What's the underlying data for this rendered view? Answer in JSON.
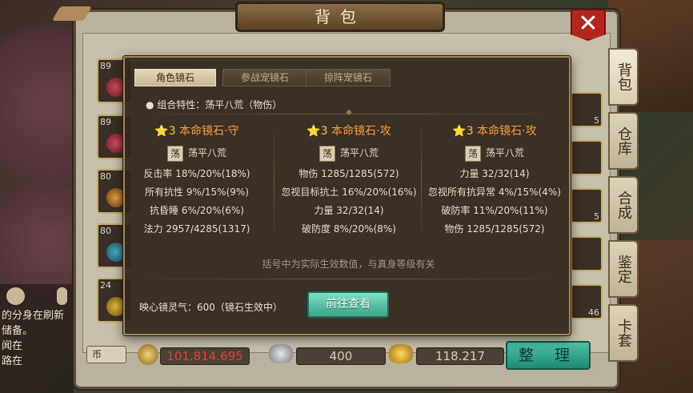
{
  "window": {
    "title": "背包",
    "close_label": "✕"
  },
  "side_tabs": [
    "背包",
    "仓库",
    "合成",
    "鉴定",
    "卡套"
  ],
  "left_slots": [
    "89",
    "89",
    "80",
    "80",
    "24"
  ],
  "right_slots": [
    "5",
    "",
    "5",
    "",
    "46"
  ],
  "currency": {
    "toggle_label": "币",
    "gold": "101.814.695",
    "silver": "400",
    "ingot": "118.217"
  },
  "tidy_label": "整 理",
  "chat_lines": [
    "的分身在刷新",
    "储备。",
    "闻在",
    "路在"
  ],
  "panel": {
    "tabs": [
      "角色镜石",
      "参战宠镜石",
      "掠阵宠镜石"
    ],
    "combo_label": "● 组合特性：荡平八荒（物伤）",
    "columns": [
      {
        "star": "⭐3",
        "title": "本命镜石·守",
        "tag_icon": "荡",
        "tag_text": "荡平八荒",
        "stats": [
          "反击率 18%/20%(18%)",
          "所有抗性 9%/15%(9%)",
          "抗昏睡 6%/20%(6%)",
          "法力 2957/4285(1317)"
        ]
      },
      {
        "star": "⭐3",
        "title": "本命镜石·攻",
        "tag_icon": "荡",
        "tag_text": "荡平八荒",
        "stats": [
          "物伤 1285/1285(572)",
          "忽视目标抗土 16%/20%(16%)",
          "力量 32/32(14)",
          "破防度 8%/20%(8%)"
        ]
      },
      {
        "star": "⭐3",
        "title": "本命镜石·攻",
        "tag_icon": "荡",
        "tag_text": "荡平八荒",
        "stats": [
          "力量 32/32(14)",
          "忽视所有抗异常 4%/15%(4%)",
          "破防率 11%/20%(11%)",
          "物伤 1285/1285(572)"
        ]
      }
    ],
    "footnote": "括号中为实际生效数值，与真身等级有关",
    "mirror_spirit": "映心镜灵气：600（镜石生效中）",
    "goto_label": "前往查看"
  },
  "colors": {
    "title_orange": "#ff9a38",
    "button_teal": "#3aa68a",
    "close_red": "#b3261e"
  }
}
